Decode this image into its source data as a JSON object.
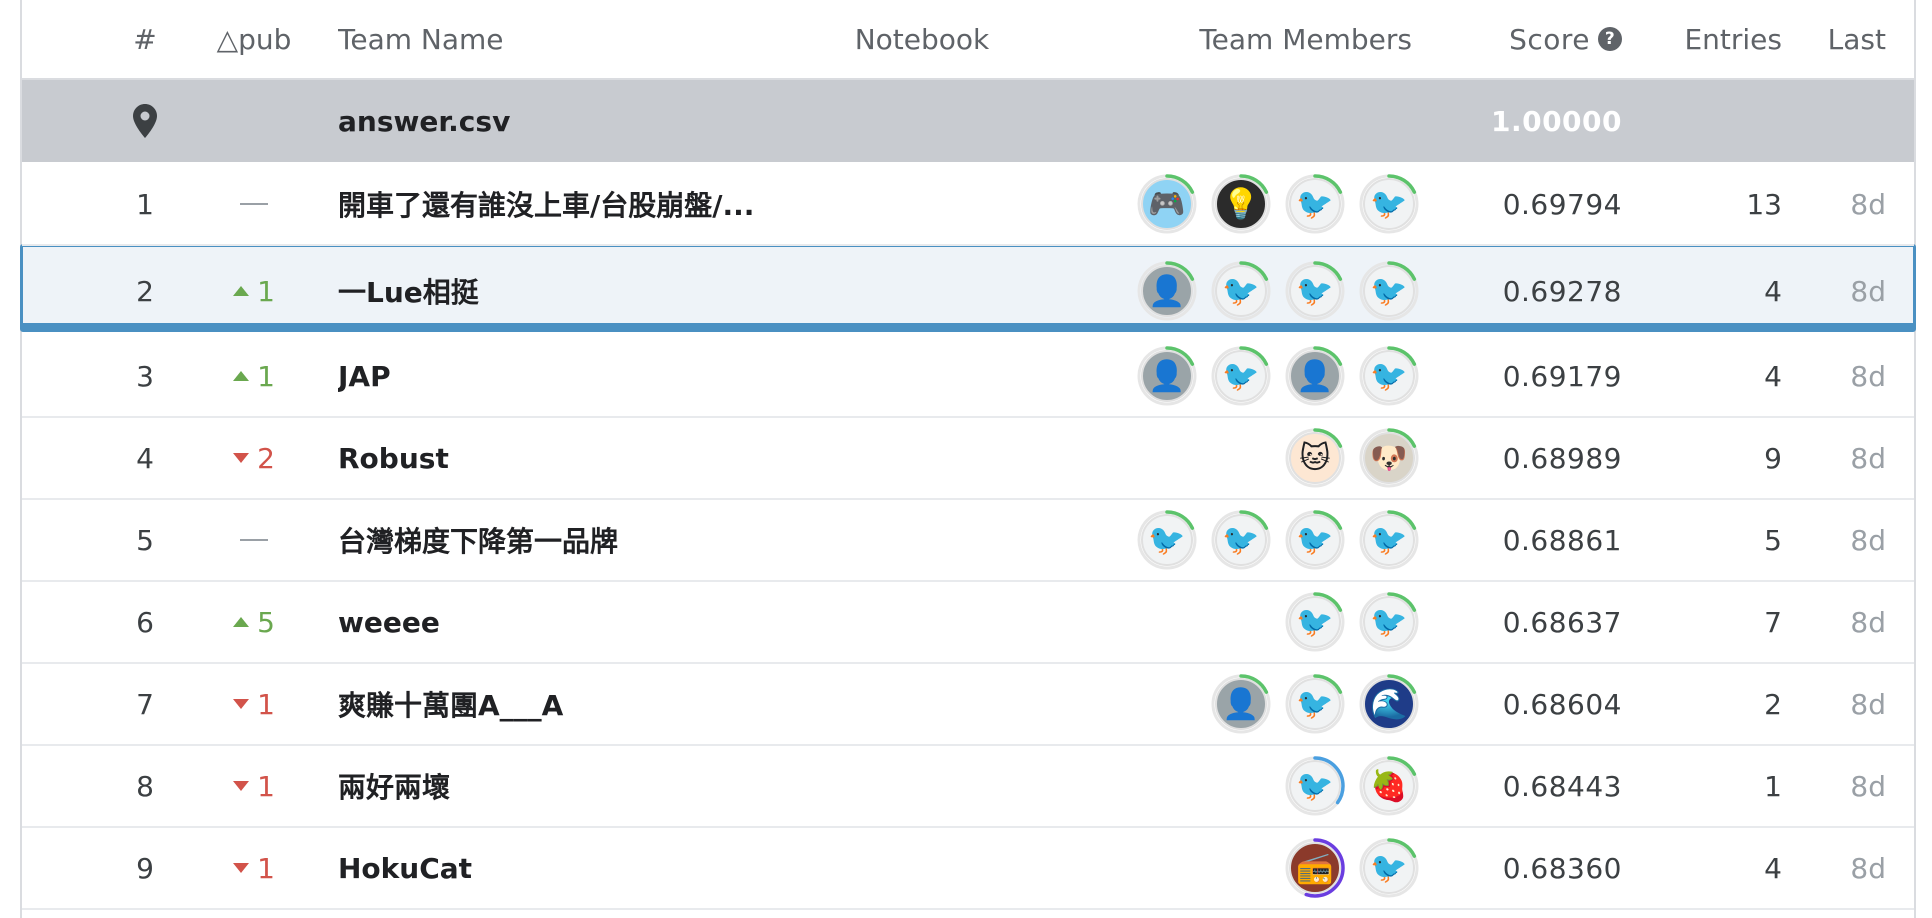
{
  "header": {
    "rank": "#",
    "delta": "△pub",
    "team_name": "Team Name",
    "notebook": "Notebook",
    "team_members": "Team Members",
    "score": "Score",
    "entries": "Entries",
    "last": "Last"
  },
  "benchmark": {
    "name": "answer.csv",
    "score": "1.00000"
  },
  "rows": [
    {
      "rank": "1",
      "delta_dir": "none",
      "delta": "",
      "team": "開車了還有誰沒上車/台股崩盤/...",
      "members": [
        "pixel",
        "dark",
        "goose",
        "goose"
      ],
      "score": "0.69794",
      "entries": "13",
      "last": "8d"
    },
    {
      "rank": "2",
      "delta_dir": "up",
      "delta": "1",
      "team": "一Lue相挺",
      "members": [
        "photo",
        "goose",
        "goose",
        "goose"
      ],
      "score": "0.69278",
      "entries": "4",
      "last": "8d",
      "selected": true
    },
    {
      "rank": "3",
      "delta_dir": "up",
      "delta": "1",
      "team": "JAP",
      "members": [
        "photo",
        "goose",
        "photo",
        "goose"
      ],
      "score": "0.69179",
      "entries": "4",
      "last": "8d"
    },
    {
      "rank": "4",
      "delta_dir": "down",
      "delta": "2",
      "team": "Robust",
      "members": [
        "cat",
        "dog"
      ],
      "score": "0.68989",
      "entries": "9",
      "last": "8d"
    },
    {
      "rank": "5",
      "delta_dir": "none",
      "delta": "",
      "team": "台灣梯度下降第一品牌",
      "members": [
        "goose",
        "goose",
        "goose",
        "goose"
      ],
      "score": "0.68861",
      "entries": "5",
      "last": "8d"
    },
    {
      "rank": "6",
      "delta_dir": "up",
      "delta": "5",
      "team": "weeee",
      "members": [
        "goose",
        "goose"
      ],
      "score": "0.68637",
      "entries": "7",
      "last": "8d"
    },
    {
      "rank": "7",
      "delta_dir": "down",
      "delta": "1",
      "team": "爽賺十萬團A___A",
      "members": [
        "photo",
        "goose",
        "blue"
      ],
      "score": "0.68604",
      "entries": "2",
      "last": "8d"
    },
    {
      "rank": "8",
      "delta_dir": "down",
      "delta": "1",
      "team": "兩好兩壞",
      "members": [
        "goose",
        "red"
      ],
      "score": "0.68443",
      "entries": "1",
      "last": "8d"
    },
    {
      "rank": "9",
      "delta_dir": "down",
      "delta": "1",
      "team": "HokuCat",
      "members": [
        "radio",
        "goose"
      ],
      "score": "0.68360",
      "entries": "4",
      "last": "8d"
    }
  ],
  "colors": {
    "up": "#6aa84f",
    "down": "#d2534a",
    "ring_green": "#5cc36b",
    "ring_blue": "#4a9fe0",
    "ring_purple": "#6a3de0",
    "selected_border": "#4a90c2"
  }
}
